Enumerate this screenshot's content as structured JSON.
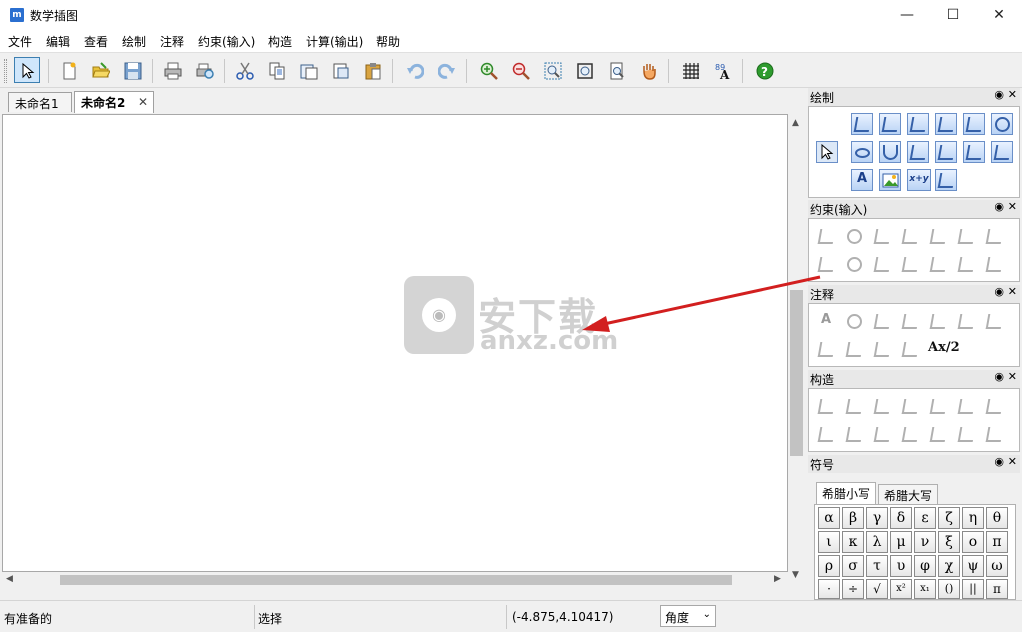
{
  "window": {
    "title": "数学插图",
    "icon_label": "m",
    "controls": [
      "minimize-icon",
      "maximize-icon",
      "close-icon"
    ]
  },
  "menu": [
    "文件",
    "编辑",
    "查看",
    "绘制",
    "注释",
    "约束(输入)",
    "构造",
    "计算(输出)",
    "帮助"
  ],
  "toolbar": {
    "icons": [
      "select-arrow-icon",
      "new-file-icon",
      "open-folder-icon",
      "save-icon",
      "print-icon",
      "print-preview-icon",
      "cut-icon",
      "copy-icon",
      "copy-doc-icon",
      "paste-special-icon",
      "paste-icon",
      "undo-icon",
      "redo-icon",
      "zoom-in-icon",
      "zoom-out-icon",
      "zoom-fit-icon",
      "zoom-frame-icon",
      "zoom-page-icon",
      "pan-hand-icon",
      "grid-icon",
      "text-style-icon",
      "help-icon"
    ]
  },
  "tabs": [
    {
      "label": "未命名1",
      "active": false
    },
    {
      "label": "未命名2",
      "active": true
    }
  ],
  "tab_close": "✕",
  "panels": {
    "draw": {
      "title": "绘制",
      "button_labels": {
        "text": "A",
        "formula": "x+y"
      }
    },
    "constraint": {
      "title": "约束(输入)"
    },
    "annotation": {
      "title": "注释",
      "button_labels": {
        "a": "A",
        "frac": "Ax/2"
      }
    },
    "construct": {
      "title": "构造"
    },
    "symbols": {
      "title": "符号",
      "tabs": [
        "希腊小写",
        "希腊大写"
      ],
      "greek_row1": [
        "α",
        "β",
        "γ",
        "δ",
        "ε",
        "ζ",
        "η",
        "θ"
      ],
      "greek_row2": [
        "ι",
        "κ",
        "λ",
        "μ",
        "ν",
        "ξ",
        "ο",
        "π"
      ],
      "greek_row3": [
        "ρ",
        "σ",
        "τ",
        "υ",
        "φ",
        "χ",
        "ψ",
        "ω"
      ],
      "math_row": [
        "·",
        "÷",
        "√",
        "x²",
        "x₁",
        "()",
        "||",
        "π"
      ]
    }
  },
  "watermark": {
    "text": "安下载",
    "url": "anxz.com"
  },
  "status": {
    "ready": "有准备的",
    "mode": "选择",
    "coords": "(-4.875,4.10417)",
    "unit": "角度"
  },
  "colors": {
    "accent": "#3c7fb1",
    "arrow": "#d21f1f",
    "help_green": "#2e9b2e"
  }
}
